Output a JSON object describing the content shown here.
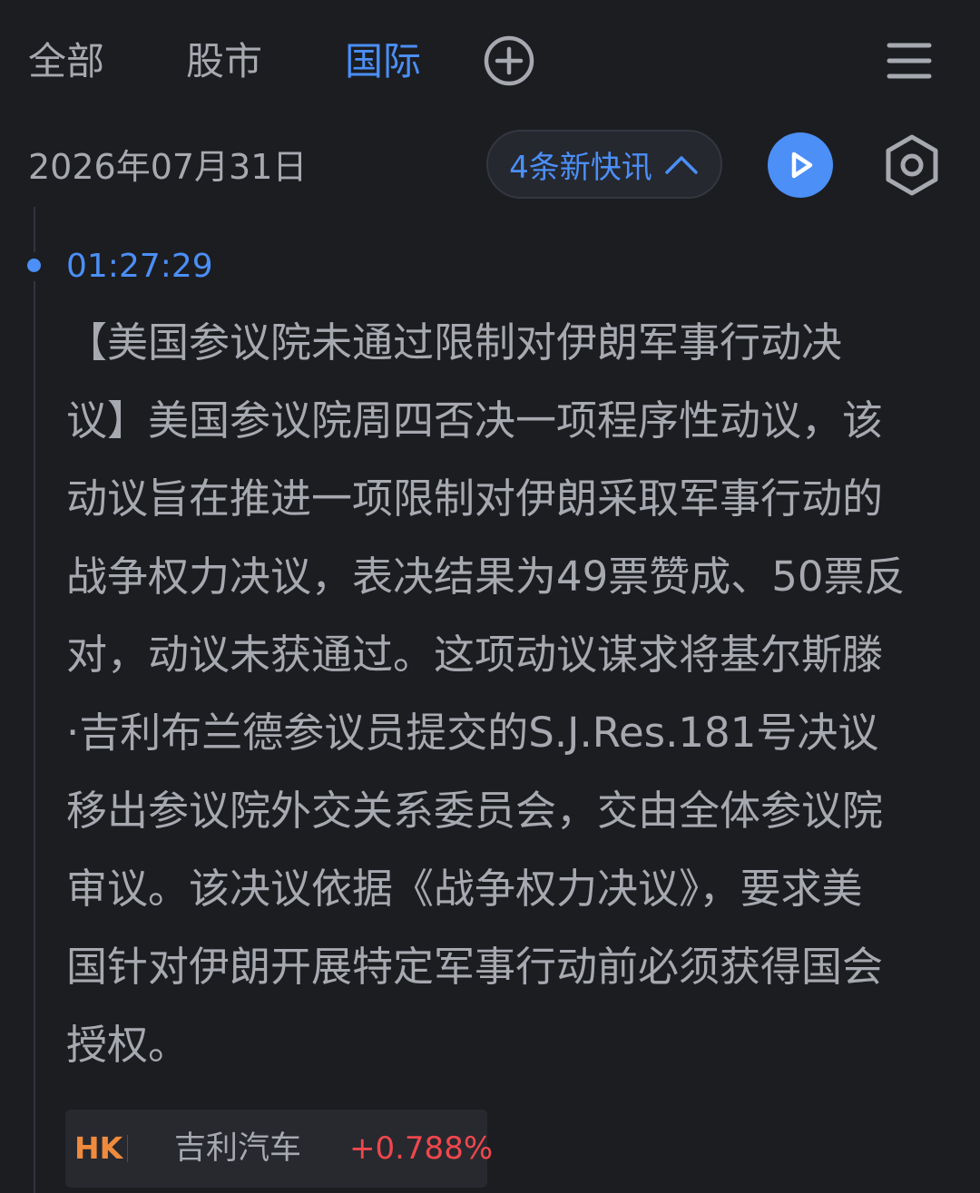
{
  "tabs": [
    {
      "label": "全部",
      "active": false
    },
    {
      "label": "股市",
      "active": false
    },
    {
      "label": "国际",
      "active": true
    }
  ],
  "header": {
    "add_icon": "plus-circle-icon",
    "menu_icon": "hamburger-menu-icon"
  },
  "date_row": {
    "date": "2026年07月31日",
    "new_items_label": "4条新快讯",
    "new_items_icon": "chevron-up-icon",
    "play_icon": "play-icon",
    "settings_icon": "hexagon-settings-icon"
  },
  "news": {
    "time": "01:27:29",
    "lines": [
      "【美国参议院未通过限制对伊朗军事行动决",
      "议】美国参议院周四否决一项程序性动议，该",
      "动议旨在推进一项限制对伊朗采取军事行动的",
      "战争权力决议，表决结果为49票赞成、50票反",
      "对，动议未获通过。这项动议谋求将基尔斯滕",
      "·吉利布兰德参议员提交的S.J.Res.181号决议",
      "移出参议院外交关系委员会，交由全体参议院",
      "审议。该决议依据《战争权力决议》，要求美",
      "国针对伊朗开展特定军事行动前必须获得国会",
      "授权。"
    ]
  },
  "stock": {
    "market": "HK",
    "name": "吉利汽车",
    "change": "+0.788%"
  },
  "colors": {
    "background": "#1c1d21",
    "accent": "#4b8ff7",
    "text": "#a7a9b0",
    "up": "#f0474c",
    "market_badge": "#f08a3c"
  }
}
